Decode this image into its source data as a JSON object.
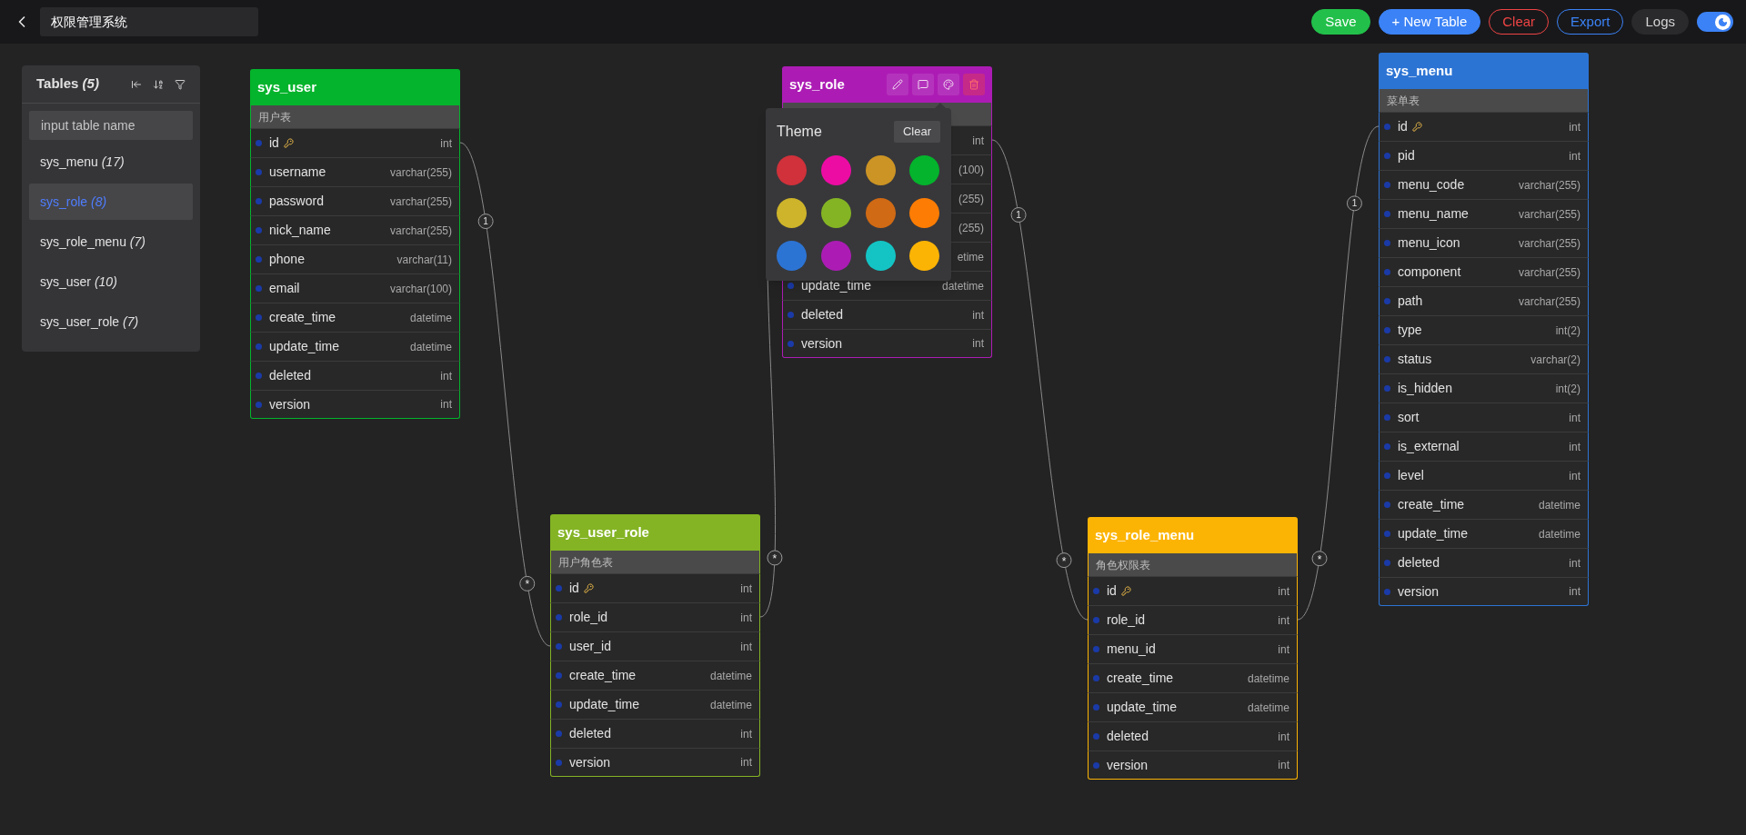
{
  "topbar": {
    "title": "权限管理系统",
    "buttons": [
      {
        "kind": "save",
        "label": "Save"
      },
      {
        "kind": "primary",
        "label": "+ New Table"
      },
      {
        "kind": "danger",
        "label": "Clear"
      },
      {
        "kind": "outline",
        "label": "Export"
      },
      {
        "kind": "plain",
        "label": "Logs"
      }
    ],
    "dark_mode": {
      "on": true
    }
  },
  "sidebar": {
    "title": "Tables",
    "count": "(5)",
    "search": {
      "placeholder": "input table name"
    },
    "items": [
      {
        "name": "sys_menu",
        "count": "(17)",
        "selected": false
      },
      {
        "name": "sys_role",
        "count": "(8)",
        "selected": true
      },
      {
        "name": "sys_role_menu",
        "count": "(7)",
        "selected": false
      },
      {
        "name": "sys_user",
        "count": "(10)",
        "selected": false
      },
      {
        "name": "sys_user_role",
        "count": "(7)",
        "selected": false
      }
    ]
  },
  "tables": [
    {
      "name": "sys_user",
      "comment": "用户表",
      "color": "#04b42c",
      "selected": false,
      "fields": [
        {
          "name": "id",
          "type": "int",
          "pk": true
        },
        {
          "name": "username",
          "type": "varchar(255)",
          "pk": false
        },
        {
          "name": "password",
          "type": "varchar(255)",
          "pk": false
        },
        {
          "name": "nick_name",
          "type": "varchar(255)",
          "pk": false
        },
        {
          "name": "phone",
          "type": "varchar(11)",
          "pk": false
        },
        {
          "name": "email",
          "type": "varchar(100)",
          "pk": false
        },
        {
          "name": "create_time",
          "type": "datetime",
          "pk": false
        },
        {
          "name": "update_time",
          "type": "datetime",
          "pk": false
        },
        {
          "name": "deleted",
          "type": "int",
          "pk": false
        },
        {
          "name": "version",
          "type": "int",
          "pk": false
        }
      ]
    },
    {
      "name": "sys_role",
      "color": "#ac1cb4",
      "selected": true,
      "fields": [
        {
          "type": "int"
        },
        {
          "type": "(100)"
        },
        {
          "type": "(255)"
        },
        {
          "type": "(255)"
        },
        {
          "type": "etime"
        },
        {
          "name": "update_time",
          "type": "datetime",
          "pk": false
        },
        {
          "name": "deleted",
          "type": "int",
          "pk": false
        },
        {
          "name": "version",
          "type": "int",
          "pk": false
        }
      ]
    },
    {
      "name": "sys_user_role",
      "comment": "用户角色表",
      "color": "#84b424",
      "selected": false,
      "fields": [
        {
          "name": "id",
          "type": "int",
          "pk": true
        },
        {
          "name": "role_id",
          "type": "int",
          "pk": false
        },
        {
          "name": "user_id",
          "type": "int",
          "pk": false
        },
        {
          "name": "create_time",
          "type": "datetime",
          "pk": false
        },
        {
          "name": "update_time",
          "type": "datetime",
          "pk": false
        },
        {
          "name": "deleted",
          "type": "int",
          "pk": false
        },
        {
          "name": "version",
          "type": "int",
          "pk": false
        }
      ]
    },
    {
      "name": "sys_role_menu",
      "comment": "角色权限表",
      "color": "#fcb404",
      "selected": false,
      "fields": [
        {
          "name": "id",
          "type": "int",
          "pk": true
        },
        {
          "name": "role_id",
          "type": "int",
          "pk": false
        },
        {
          "name": "menu_id",
          "type": "int",
          "pk": false
        },
        {
          "name": "create_time",
          "type": "datetime",
          "pk": false
        },
        {
          "name": "update_time",
          "type": "datetime",
          "pk": false
        },
        {
          "name": "deleted",
          "type": "int",
          "pk": false
        },
        {
          "name": "version",
          "type": "int",
          "pk": false
        }
      ]
    },
    {
      "name": "sys_menu",
      "comment": "菜单表",
      "color": "#2c74d4",
      "selected": false,
      "fields": [
        {
          "name": "id",
          "type": "int",
          "pk": true
        },
        {
          "name": "pid",
          "type": "int",
          "pk": false
        },
        {
          "name": "menu_code",
          "type": "varchar(255)",
          "pk": false
        },
        {
          "name": "menu_name",
          "type": "varchar(255)",
          "pk": false
        },
        {
          "name": "menu_icon",
          "type": "varchar(255)",
          "pk": false
        },
        {
          "name": "component",
          "type": "varchar(255)",
          "pk": false
        },
        {
          "name": "path",
          "type": "varchar(255)",
          "pk": false
        },
        {
          "name": "type",
          "type": "int(2)",
          "pk": false
        },
        {
          "name": "status",
          "type": "varchar(2)",
          "pk": false
        },
        {
          "name": "is_hidden",
          "type": "int(2)",
          "pk": false
        },
        {
          "name": "sort",
          "type": "int",
          "pk": false
        },
        {
          "name": "is_external",
          "type": "int",
          "pk": false
        },
        {
          "name": "level",
          "type": "int",
          "pk": false
        },
        {
          "name": "create_time",
          "type": "datetime",
          "pk": false
        },
        {
          "name": "update_time",
          "type": "datetime",
          "pk": false
        },
        {
          "name": "deleted",
          "type": "int",
          "pk": false
        },
        {
          "name": "version",
          "type": "int",
          "pk": false
        }
      ]
    }
  ],
  "relations": [
    {
      "one_label": "1",
      "many_label": "*"
    },
    {
      "many_label": "*"
    },
    {
      "one_label": "1",
      "many_label": "*"
    },
    {
      "one_label": "1",
      "many_label": "*"
    }
  ],
  "theme_popover": {
    "title": "Theme",
    "clear": "Clear",
    "swatches": [
      {
        "color": "#d0313a"
      },
      {
        "color": "#ec0ca4"
      },
      {
        "color": "#cc9424"
      },
      {
        "color": "#04b42c"
      },
      {
        "color": "#ceb42a"
      },
      {
        "color": "#84b424"
      },
      {
        "color": "#d06a14"
      },
      {
        "color": "#fc7c04"
      },
      {
        "color": "#2c74d4"
      },
      {
        "color": "#ac1cb4"
      },
      {
        "color": "#14c4c4"
      },
      {
        "color": "#fcb404"
      }
    ]
  }
}
